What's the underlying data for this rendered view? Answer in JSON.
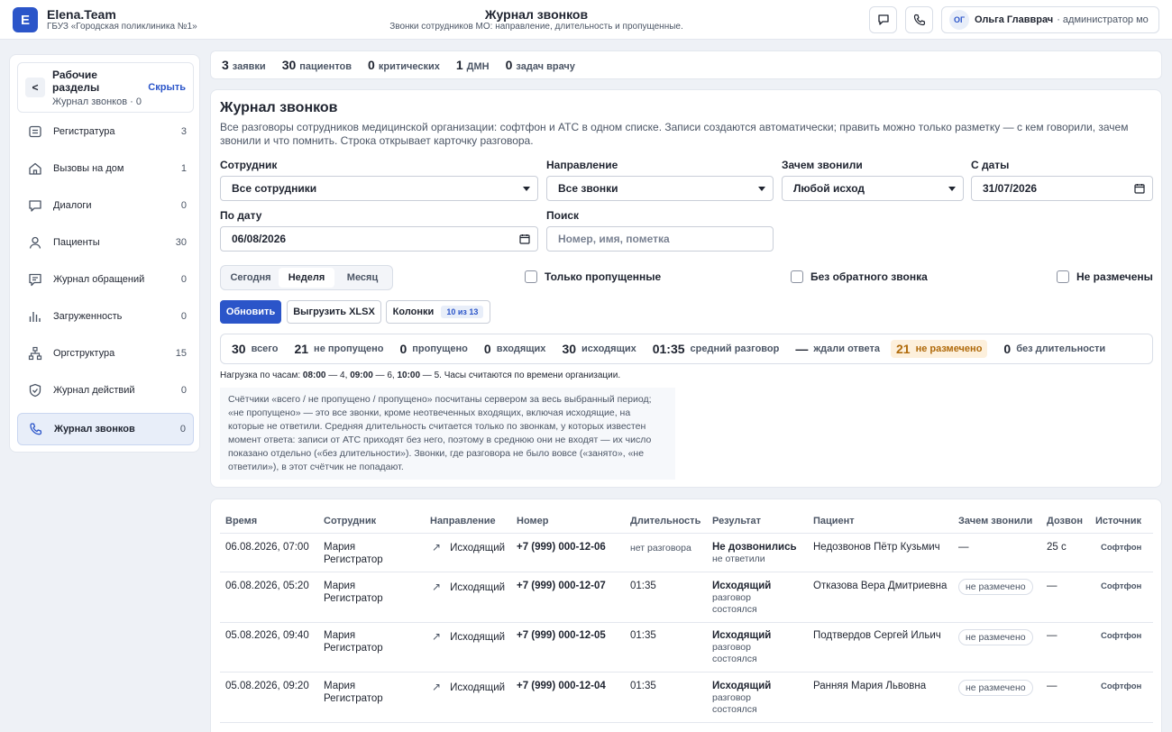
{
  "header": {
    "logo_letter": "E",
    "brand": "Elena.Team",
    "org": "ГБУЗ «Городская поликлиника №1»",
    "title": "Журнал звонков",
    "subtitle": "Звонки сотрудников МО: направление, длительность и пропущенные.",
    "user_initials": "ОГ",
    "user_name": "Ольга Главврач",
    "user_role": "· администратор мо"
  },
  "sidebar": {
    "collapse": "<",
    "title": "Рабочие разделы",
    "hide": "Скрыть",
    "subtitle": "Журнал звонков · 0",
    "items": [
      {
        "label": "Регистратура",
        "count": "3",
        "icon": "registry-icon"
      },
      {
        "label": "Вызовы на дом",
        "count": "1",
        "icon": "home-icon"
      },
      {
        "label": "Диалоги",
        "count": "0",
        "icon": "chat-icon"
      },
      {
        "label": "Пациенты",
        "count": "30",
        "icon": "user-icon"
      },
      {
        "label": "Журнал обращений",
        "count": "0",
        "icon": "message-icon"
      },
      {
        "label": "Загруженность",
        "count": "0",
        "icon": "bars-icon"
      },
      {
        "label": "Оргструктура",
        "count": "15",
        "icon": "org-icon"
      },
      {
        "label": "Журнал действий",
        "count": "0",
        "icon": "shield-icon"
      },
      {
        "label": "Журнал звонков",
        "count": "0",
        "icon": "phone-icon"
      }
    ]
  },
  "stats": [
    {
      "value": "3",
      "label": "заявки"
    },
    {
      "value": "30",
      "label": "пациентов"
    },
    {
      "value": "0",
      "label": "критических"
    },
    {
      "value": "1",
      "label": "ДМН"
    },
    {
      "value": "0",
      "label": "задач врачу"
    }
  ],
  "panel": {
    "title": "Журнал звонков",
    "description": "Все разговоры сотрудников медицинской организации: софтфон и АТС в одном списке. Записи создаются автоматически; править можно только разметку — с кем говорили, зачем звонили и что помнить. Строка открывает карточку разговора.",
    "filters": {
      "employee_label": "Сотрудник",
      "employee_value": "Все сотрудники",
      "direction_label": "Направление",
      "direction_value": "Все звонки",
      "reason_label": "Зачем звонили",
      "reason_value": "Любой исход",
      "from_label": "С даты",
      "from_value": "31/07/2026",
      "to_label": "По дату",
      "to_value": "06/08/2026",
      "search_label": "Поиск",
      "search_placeholder": "Номер, имя, пометка"
    },
    "periods": [
      "Сегодня",
      "Неделя",
      "Месяц"
    ],
    "checks": [
      "Только пропущенные",
      "Без обратного звонка",
      "Не размечены"
    ],
    "buttons": {
      "refresh": "Обновить",
      "export": "Выгрузить XLSX",
      "columns": "Колонки",
      "columns_badge": "10 из 13"
    },
    "summary": [
      {
        "value": "30",
        "label": "всего"
      },
      {
        "value": "21",
        "label": "не пропущено"
      },
      {
        "value": "0",
        "label": "пропущено"
      },
      {
        "value": "0",
        "label": "входящих"
      },
      {
        "value": "30",
        "label": "исходящих"
      },
      {
        "value": "01:35",
        "label": "средний разговор"
      },
      {
        "value": "—",
        "label": "ждали ответа"
      },
      {
        "value": "21",
        "label": "не размечено"
      },
      {
        "value": "0",
        "label": "без длительности"
      }
    ],
    "load": {
      "prefix": "Нагрузка по часам:",
      "h1": "08:00",
      "v1": " — 4, ",
      "h2": "09:00",
      "v2": " — 6, ",
      "h3": "10:00",
      "v3": " — 5. Часы считаются по времени организации."
    },
    "note": "Счётчики «всего / не пропущено / пропущено» посчитаны сервером за весь выбранный период; «не пропущено» — это все звонки, кроме неотвеченных входящих, включая исходящие, на которые не ответили. Средняя длительность считается только по звонкам, у которых известен момент ответа: записи от АТС приходят без него, поэтому в среднюю они не входят — их число показано отдельно («без длительности»). Звонки, где разговора не было вовсе («занято», «не ответили»), в этот счётчик не попадают."
  },
  "table": {
    "columns": [
      "Время",
      "Сотрудник",
      "Направление",
      "Номер",
      "Длительность",
      "Результат",
      "Пациент",
      "Зачем звонили",
      "Дозвон",
      "Источник"
    ],
    "rows": [
      {
        "time": "06.08.2026, 07:00",
        "employee": "Мария Регистратор",
        "direction": "Исходящий",
        "number": "+7 (999) 000-12-06",
        "duration": "нет разговора",
        "result": "Не дозвонились",
        "result_sub": "не ответили",
        "patient": "Недозвонов Пётр Кузьмич",
        "reason": "—",
        "ring": "25 с",
        "source": "Софтфон"
      },
      {
        "time": "06.08.2026, 05:20",
        "employee": "Мария Регистратор",
        "direction": "Исходящий",
        "number": "+7 (999) 000-12-07",
        "duration": "01:35",
        "result": "Исходящий",
        "result_sub": "разговор состоялся",
        "patient": "Отказова Вера Дмитриевна",
        "reason": "не размечено",
        "ring": "—",
        "source": "Софтфон"
      },
      {
        "time": "05.08.2026, 09:40",
        "employee": "Мария Регистратор",
        "direction": "Исходящий",
        "number": "+7 (999) 000-12-05",
        "duration": "01:35",
        "result": "Исходящий",
        "result_sub": "разговор состоялся",
        "patient": "Подтвердов Сергей Ильич",
        "reason": "не размечено",
        "ring": "—",
        "source": "Софтфон"
      },
      {
        "time": "05.08.2026, 09:20",
        "employee": "Мария Регистратор",
        "direction": "Исходящий",
        "number": "+7 (999) 000-12-04",
        "duration": "01:35",
        "result": "Исходящий",
        "result_sub": "разговор состоялся",
        "patient": "Ранняя Мария Львовна",
        "reason": "не размечено",
        "ring": "—",
        "source": "Софтфон"
      }
    ]
  },
  "colors": {
    "accent": "#2b55c9",
    "highlight_bg": "#fdf0dc",
    "highlight_text": "#b06a0a"
  }
}
